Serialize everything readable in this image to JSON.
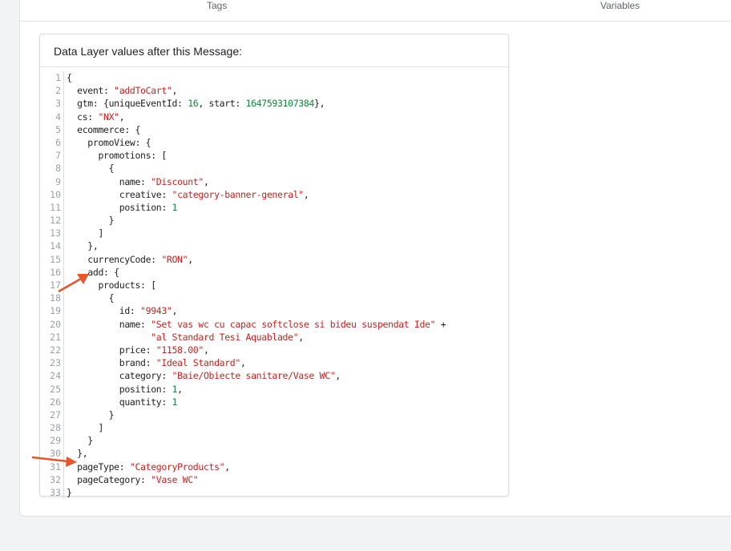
{
  "tabs": {
    "tags": "Tags",
    "variables": "Variables"
  },
  "card": {
    "title": "Data Layer values after this Message:"
  },
  "colors": {
    "string": "#c5221f",
    "number": "#188038",
    "arrow": "#e8542b"
  },
  "code": {
    "lines": [
      {
        "n": "1",
        "ind": "",
        "segs": [
          [
            "t",
            "{"
          ]
        ]
      },
      {
        "n": "2",
        "ind": "  ",
        "segs": [
          [
            "t",
            "event: "
          ],
          [
            "s",
            "\"addToCart\""
          ],
          [
            "t",
            ","
          ]
        ]
      },
      {
        "n": "3",
        "ind": "  ",
        "segs": [
          [
            "t",
            "gtm: {uniqueEventId: "
          ],
          [
            "n",
            "16"
          ],
          [
            "t",
            ", start: "
          ],
          [
            "n",
            "1647593107384"
          ],
          [
            "t",
            "},"
          ]
        ]
      },
      {
        "n": "4",
        "ind": "  ",
        "segs": [
          [
            "t",
            "cs: "
          ],
          [
            "s",
            "\"NX\""
          ],
          [
            "t",
            ","
          ]
        ]
      },
      {
        "n": "5",
        "ind": "  ",
        "segs": [
          [
            "t",
            "ecommerce: {"
          ]
        ]
      },
      {
        "n": "6",
        "ind": "    ",
        "segs": [
          [
            "t",
            "promoView: {"
          ]
        ]
      },
      {
        "n": "7",
        "ind": "      ",
        "segs": [
          [
            "t",
            "promotions: ["
          ]
        ]
      },
      {
        "n": "8",
        "ind": "        ",
        "segs": [
          [
            "t",
            "{"
          ]
        ]
      },
      {
        "n": "9",
        "ind": "          ",
        "segs": [
          [
            "t",
            "name: "
          ],
          [
            "s",
            "\"Discount\""
          ],
          [
            "t",
            ","
          ]
        ]
      },
      {
        "n": "10",
        "ind": "          ",
        "segs": [
          [
            "t",
            "creative: "
          ],
          [
            "s",
            "\"category-banner-general\""
          ],
          [
            "t",
            ","
          ]
        ]
      },
      {
        "n": "11",
        "ind": "          ",
        "segs": [
          [
            "t",
            "position: "
          ],
          [
            "n",
            "1"
          ]
        ]
      },
      {
        "n": "12",
        "ind": "        ",
        "segs": [
          [
            "t",
            "}"
          ]
        ]
      },
      {
        "n": "13",
        "ind": "      ",
        "segs": [
          [
            "t",
            "]"
          ]
        ]
      },
      {
        "n": "14",
        "ind": "    ",
        "segs": [
          [
            "t",
            "},"
          ]
        ]
      },
      {
        "n": "15",
        "ind": "    ",
        "segs": [
          [
            "t",
            "currencyCode: "
          ],
          [
            "s",
            "\"RON\""
          ],
          [
            "t",
            ","
          ]
        ]
      },
      {
        "n": "16",
        "ind": "    ",
        "segs": [
          [
            "t",
            "add: {"
          ]
        ]
      },
      {
        "n": "17",
        "ind": "      ",
        "segs": [
          [
            "t",
            "products: ["
          ]
        ]
      },
      {
        "n": "18",
        "ind": "        ",
        "segs": [
          [
            "t",
            "{"
          ]
        ]
      },
      {
        "n": "19",
        "ind": "          ",
        "segs": [
          [
            "t",
            "id: "
          ],
          [
            "s",
            "\"9943\""
          ],
          [
            "t",
            ","
          ]
        ]
      },
      {
        "n": "20",
        "ind": "          ",
        "segs": [
          [
            "t",
            "name: "
          ],
          [
            "s",
            "\"Set vas wc cu capac softclose si bideu suspendat Ide\""
          ],
          [
            "t",
            " +"
          ]
        ]
      },
      {
        "n": "21",
        "ind": "                ",
        "segs": [
          [
            "s",
            "\"al Standard Tesi Aquablade\""
          ],
          [
            "t",
            ","
          ]
        ]
      },
      {
        "n": "22",
        "ind": "          ",
        "segs": [
          [
            "t",
            "price: "
          ],
          [
            "s",
            "\"1158.00\""
          ],
          [
            "t",
            ","
          ]
        ]
      },
      {
        "n": "23",
        "ind": "          ",
        "segs": [
          [
            "t",
            "brand: "
          ],
          [
            "s",
            "\"Ideal Standard\""
          ],
          [
            "t",
            ","
          ]
        ]
      },
      {
        "n": "24",
        "ind": "          ",
        "segs": [
          [
            "t",
            "category: "
          ],
          [
            "s",
            "\"Baie/Obiecte sanitare/Vase WC\""
          ],
          [
            "t",
            ","
          ]
        ]
      },
      {
        "n": "25",
        "ind": "          ",
        "segs": [
          [
            "t",
            "position: "
          ],
          [
            "n",
            "1"
          ],
          [
            "t",
            ","
          ]
        ]
      },
      {
        "n": "26",
        "ind": "          ",
        "segs": [
          [
            "t",
            "quantity: "
          ],
          [
            "n",
            "1"
          ]
        ]
      },
      {
        "n": "27",
        "ind": "        ",
        "segs": [
          [
            "t",
            "}"
          ]
        ]
      },
      {
        "n": "28",
        "ind": "      ",
        "segs": [
          [
            "t",
            "]"
          ]
        ]
      },
      {
        "n": "29",
        "ind": "    ",
        "segs": [
          [
            "t",
            "}"
          ]
        ]
      },
      {
        "n": "30",
        "ind": "  ",
        "segs": [
          [
            "t",
            "},"
          ]
        ]
      },
      {
        "n": "31",
        "ind": "  ",
        "segs": [
          [
            "t",
            "pageType: "
          ],
          [
            "s",
            "\"CategoryProducts\""
          ],
          [
            "t",
            ","
          ]
        ]
      },
      {
        "n": "32",
        "ind": "  ",
        "segs": [
          [
            "t",
            "pageCategory: "
          ],
          [
            "s",
            "\"Vase WC\""
          ]
        ]
      },
      {
        "n": "33",
        "ind": "",
        "segs": [
          [
            "t",
            "}"
          ]
        ]
      }
    ]
  }
}
